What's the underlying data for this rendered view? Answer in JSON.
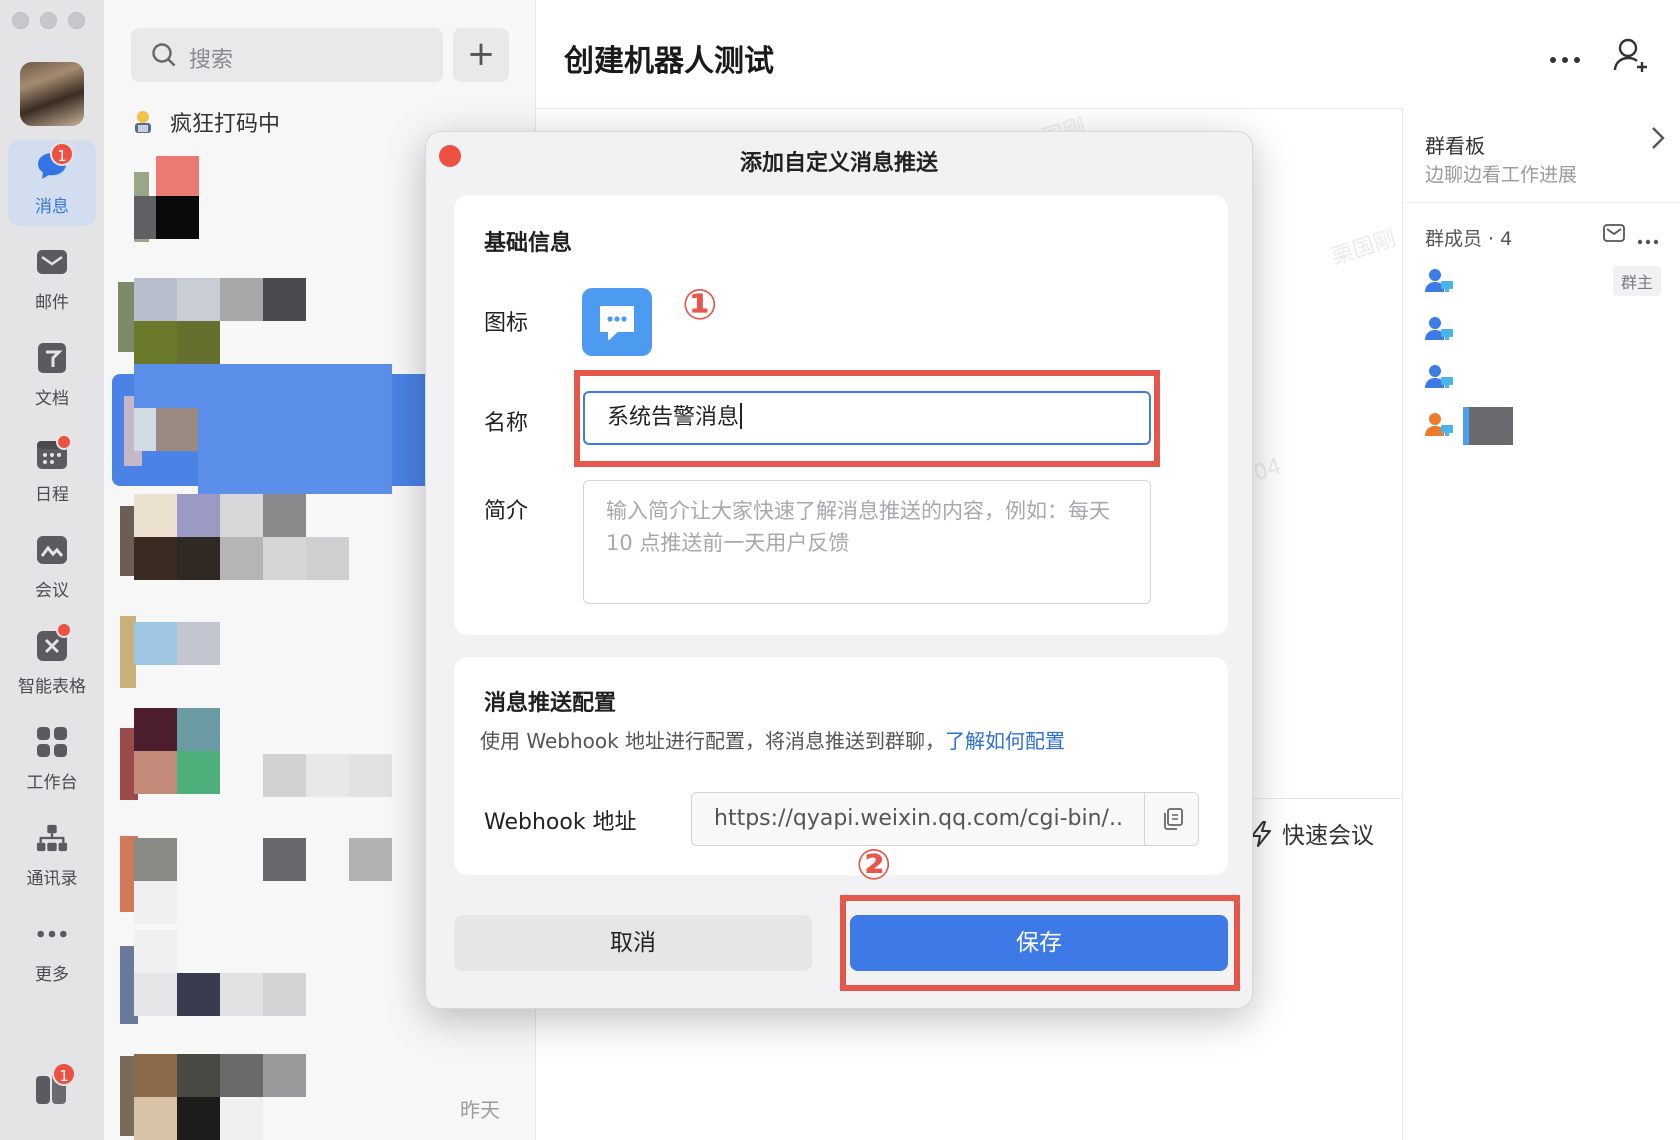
{
  "rail": {
    "items": [
      {
        "label": "消息",
        "icon": "chat-bubble-icon",
        "badge": "1",
        "active": true
      },
      {
        "label": "邮件",
        "icon": "mail-icon"
      },
      {
        "label": "文档",
        "icon": "docs-icon"
      },
      {
        "label": "日程",
        "icon": "calendar-icon",
        "dot": true
      },
      {
        "label": "会议",
        "icon": "meeting-icon"
      },
      {
        "label": "智能表格",
        "icon": "smart-sheet-icon",
        "dot": true
      },
      {
        "label": "工作台",
        "icon": "workbench-icon"
      },
      {
        "label": "通讯录",
        "icon": "contacts-icon"
      },
      {
        "label": "更多",
        "icon": "more-icon"
      }
    ],
    "bottom_badge": "1"
  },
  "list": {
    "search_placeholder": "搜索",
    "add_label": "+",
    "status": "疯狂打码中",
    "last_time": "昨天"
  },
  "chat": {
    "title": "创建机器人测试",
    "quick_meeting": "快速会议"
  },
  "side": {
    "board_title": "群看板",
    "board_sub": "边聊边看工作进展",
    "members_title": "群成员 · 4",
    "owner_tag": "群主"
  },
  "modal": {
    "title": "添加自定义消息推送",
    "basic_title": "基础信息",
    "icon_label": "图标",
    "marker1": "①",
    "name_label": "名称",
    "name_value": "系统告警消息",
    "desc_label": "简介",
    "desc_placeholder": "输入简介让大家快速了解消息推送的内容，例如：每天 10 点推送前一天用户反馈",
    "config_title": "消息推送配置",
    "config_desc": "使用 Webhook 地址进行配置，将消息推送到群聊，",
    "config_link": "了解如何配置",
    "webhook_label": "Webhook 地址",
    "webhook_value": "https://qyapi.weixin.qq.com/cgi-bin/...",
    "marker2": "②",
    "cancel": "取消",
    "save": "保存"
  },
  "colors": {
    "accent": "#3e7ae6",
    "highlight": "#e4574a",
    "badge": "#ec5143"
  }
}
